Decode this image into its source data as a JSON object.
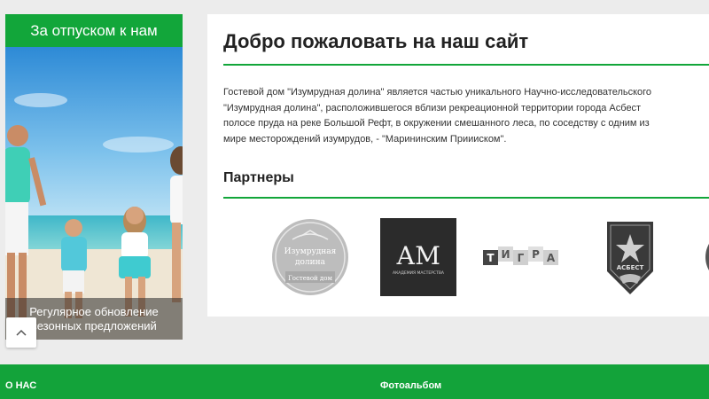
{
  "promo": {
    "title": "За отпуском к нам",
    "caption_line1": "Регулярное обновление",
    "caption_line2": "сезонных предложений"
  },
  "main": {
    "title": "Добро пожаловать на наш сайт",
    "intro_lines": [
      "Гостевой дом \"Изумрудная долина\" является частью уникального Научно-исследовательского",
      "\"Изумрудная долина\", расположившегося вблизи рекреационной территории города Асбест",
      "полосе пруда на реке Большой Рефт, в окружении смешанного леса, по соседству с одним из",
      "мире месторождений изумрудов, - \"Марининским Приииском\"."
    ],
    "partners_title": "Партнеры",
    "partners": {
      "dolina": {
        "line1": "Изумрудная",
        "line2": "долина",
        "line3": "Гостевой дом"
      },
      "am": {
        "letters": "АМ",
        "sub": "АКАДЕМИЯ МАСТЕРСТВА"
      },
      "tigra": {
        "letters": [
          "Т",
          "И",
          "Г",
          "Р",
          "А"
        ]
      },
      "asbest": {
        "text": "АСБЕСТ"
      }
    }
  },
  "footer": {
    "col1": "О НАС",
    "col2": "Фотоальбом"
  },
  "colors": {
    "accent": "#12a63a",
    "background": "#ececec"
  }
}
